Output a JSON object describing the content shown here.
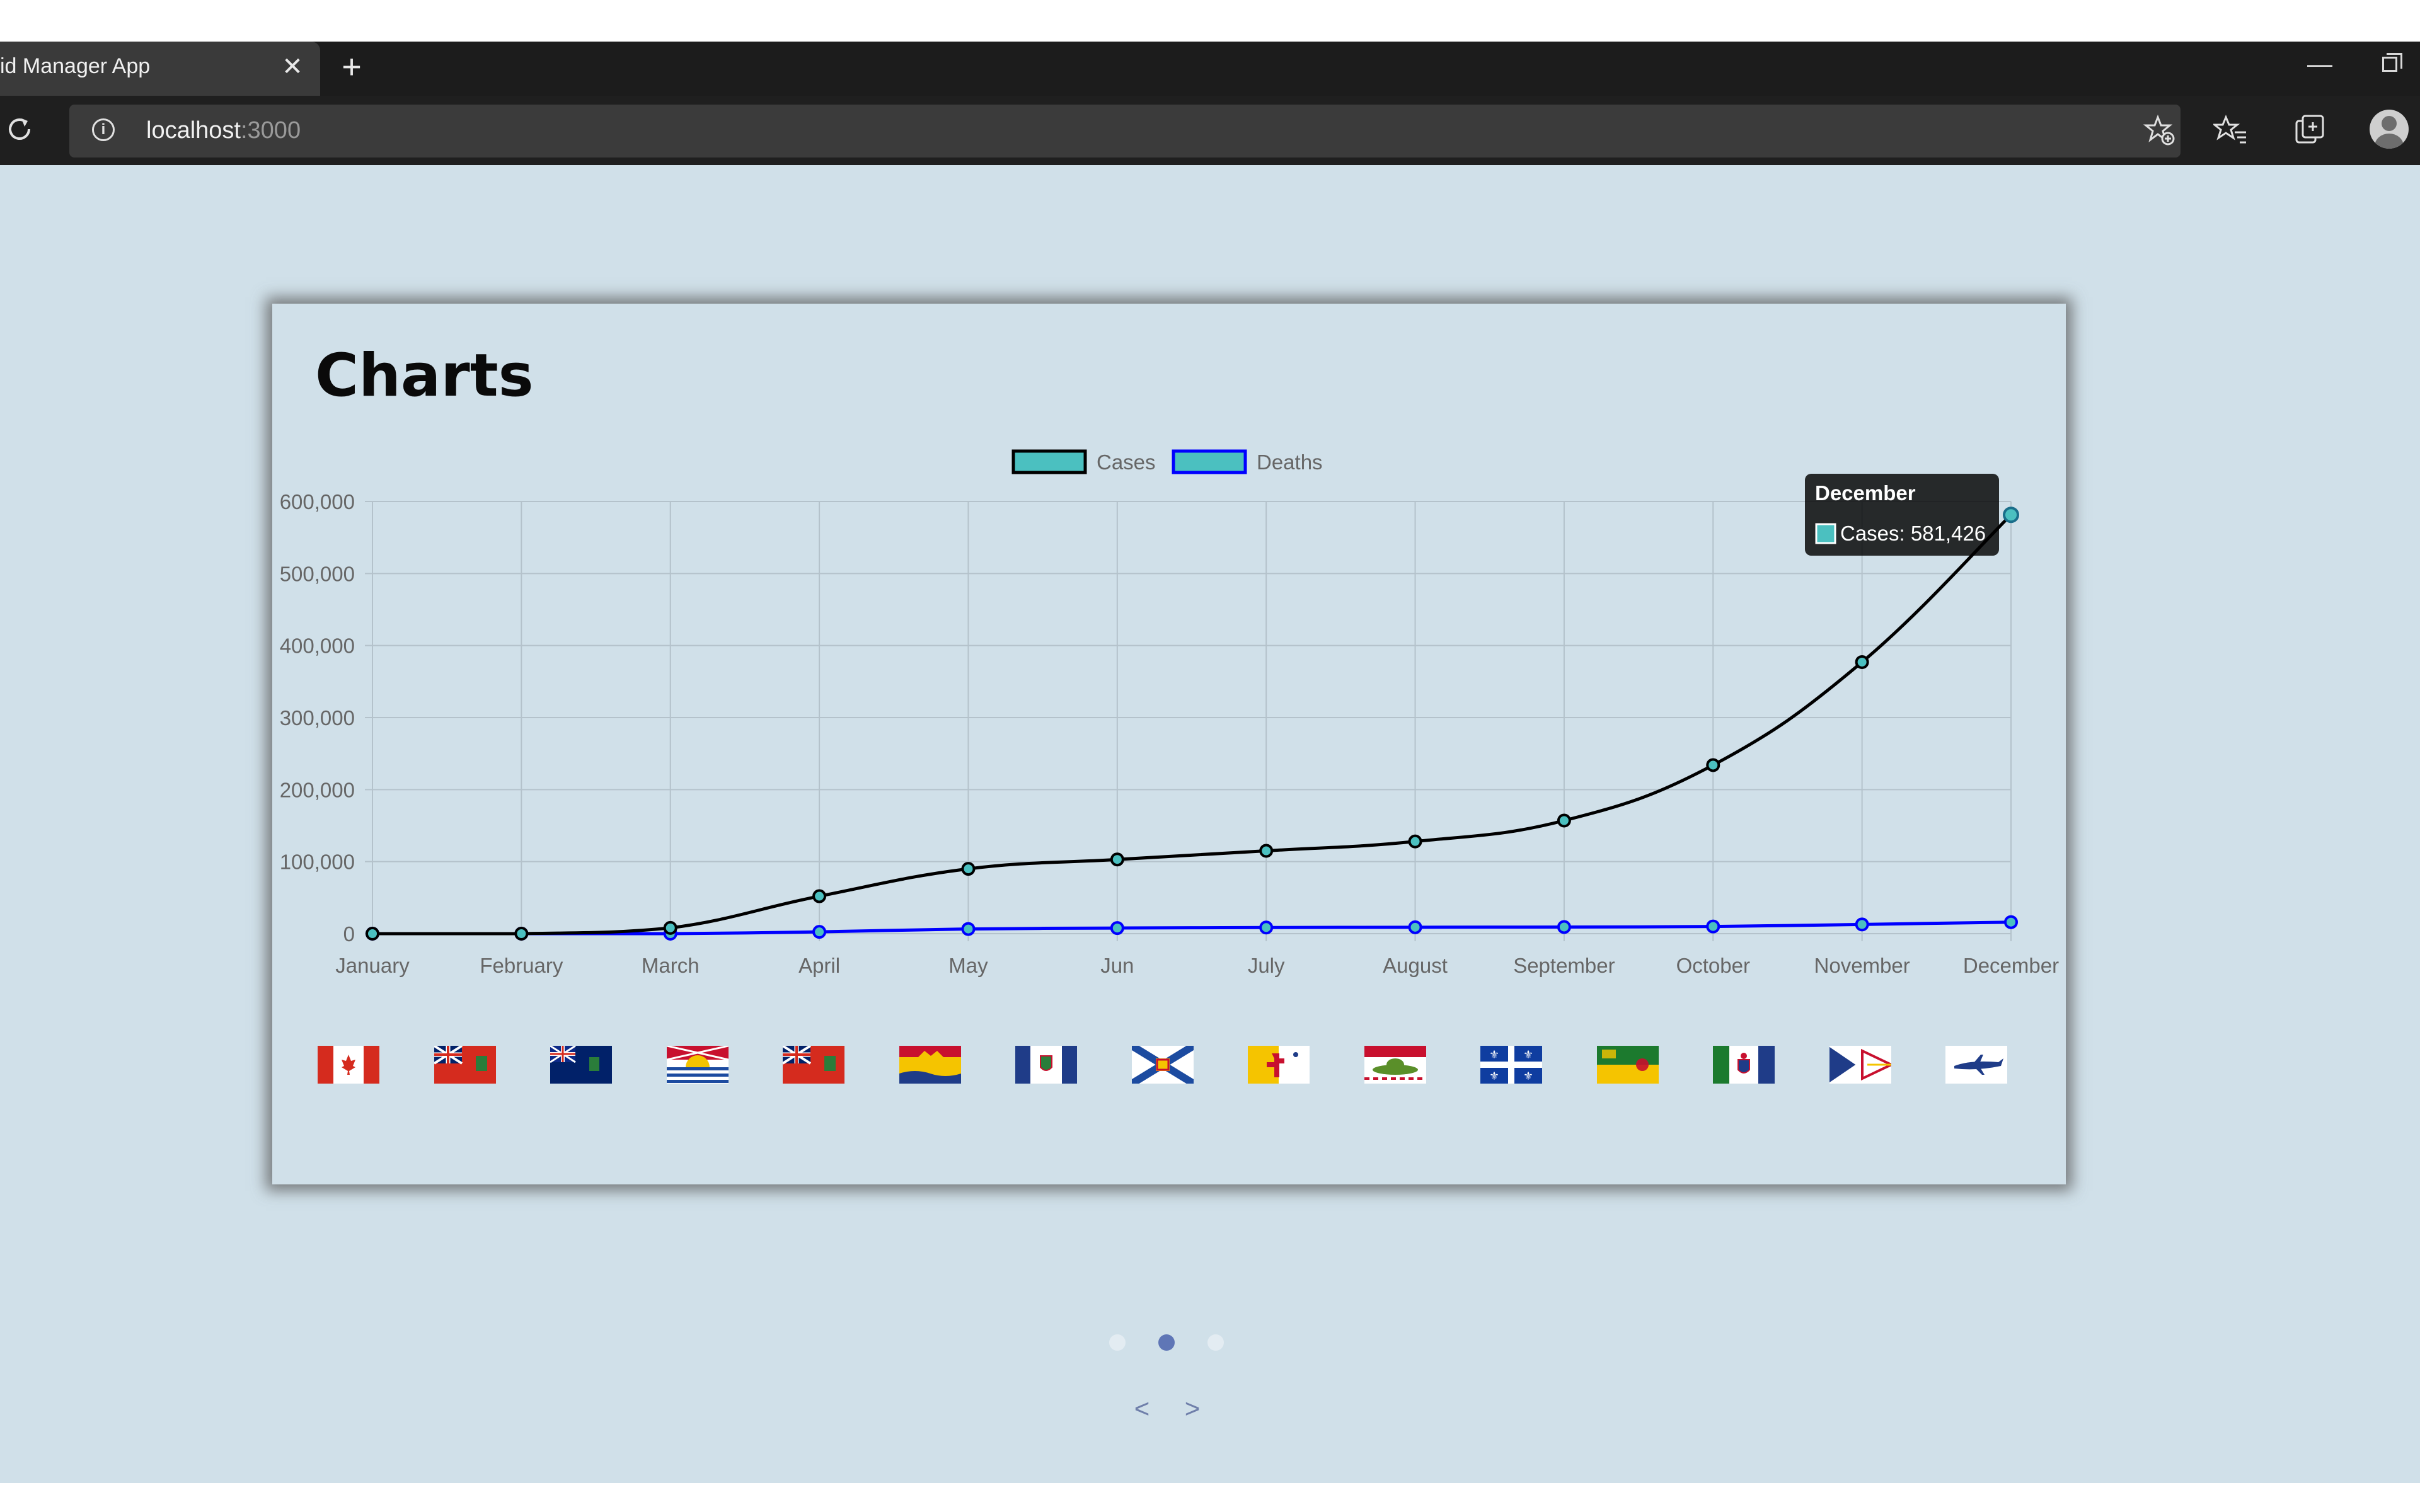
{
  "browser": {
    "tab_title": "id Manager App",
    "tab_close": "✕",
    "new_tab": "+",
    "minimize": "—",
    "url_host": "localhost",
    "url_port": ":3000",
    "info_glyph": "i"
  },
  "page": {
    "title": "Charts",
    "carousel": {
      "dots": 3,
      "active_index": 1,
      "prev_label": "<",
      "next_label": ">"
    },
    "flags": [
      {
        "name": "flag-canada",
        "colors": [
          "#d52b1e",
          "#ffffff"
        ]
      },
      {
        "name": "flag-ontario",
        "colors": [
          "#d52b1e",
          "#012169"
        ]
      },
      {
        "name": "flag-manitoba",
        "colors": [
          "#012169",
          "#d52b1e"
        ]
      },
      {
        "name": "flag-british-columbia",
        "colors": [
          "#ffffff",
          "#1c4ba0",
          "#f5c400"
        ]
      },
      {
        "name": "flag-ontario-alt",
        "colors": [
          "#d52b1e",
          "#012169"
        ]
      },
      {
        "name": "flag-new-brunswick",
        "colors": [
          "#f5c400",
          "#c8102e"
        ]
      },
      {
        "name": "flag-northwest-territories",
        "colors": [
          "#1f3c88",
          "#ffffff"
        ]
      },
      {
        "name": "flag-nova-scotia",
        "colors": [
          "#ffffff",
          "#1c4ba0"
        ]
      },
      {
        "name": "flag-nunavut",
        "colors": [
          "#f5c400",
          "#ffffff",
          "#c8102e"
        ]
      },
      {
        "name": "flag-prince-edward-island",
        "colors": [
          "#ffffff",
          "#c8102e",
          "#5a8f29"
        ]
      },
      {
        "name": "flag-quebec",
        "colors": [
          "#0f3da0",
          "#ffffff"
        ]
      },
      {
        "name": "flag-saskatchewan",
        "colors": [
          "#1c7a2e",
          "#f5c400"
        ]
      },
      {
        "name": "flag-yukon",
        "colors": [
          "#1b7a2e",
          "#ffffff",
          "#1f3c88"
        ]
      },
      {
        "name": "flag-newfoundland",
        "colors": [
          "#ffffff",
          "#1f3c88",
          "#c8102e"
        ]
      },
      {
        "name": "flag-plane",
        "colors": [
          "#ffffff",
          "#1f3c88"
        ]
      }
    ]
  },
  "chart_data": {
    "type": "line",
    "categories": [
      "January",
      "February",
      "March",
      "April",
      "May",
      "Jun",
      "July",
      "August",
      "September",
      "October",
      "November",
      "December"
    ],
    "series": [
      {
        "name": "Cases",
        "color": "#000000",
        "fill": "#4bc0c0",
        "values": [
          0,
          0,
          8000,
          52000,
          90000,
          103000,
          115000,
          128000,
          157000,
          234000,
          377000,
          581426
        ]
      },
      {
        "name": "Deaths",
        "color": "#0000ff",
        "fill": "#4bc0c0",
        "values": [
          0,
          0,
          0,
          2500,
          6500,
          7800,
          8500,
          8900,
          9200,
          10000,
          12800,
          16000
        ]
      }
    ],
    "y_ticks": [
      "600,000",
      "500,000",
      "400,000",
      "300,000",
      "200,000",
      "100,000",
      "0"
    ],
    "ylim": [
      0,
      600000
    ],
    "grid": true,
    "legend": "top-center",
    "tooltip": {
      "category_index": 11,
      "title": "December",
      "label": "Cases: 581,426"
    }
  }
}
